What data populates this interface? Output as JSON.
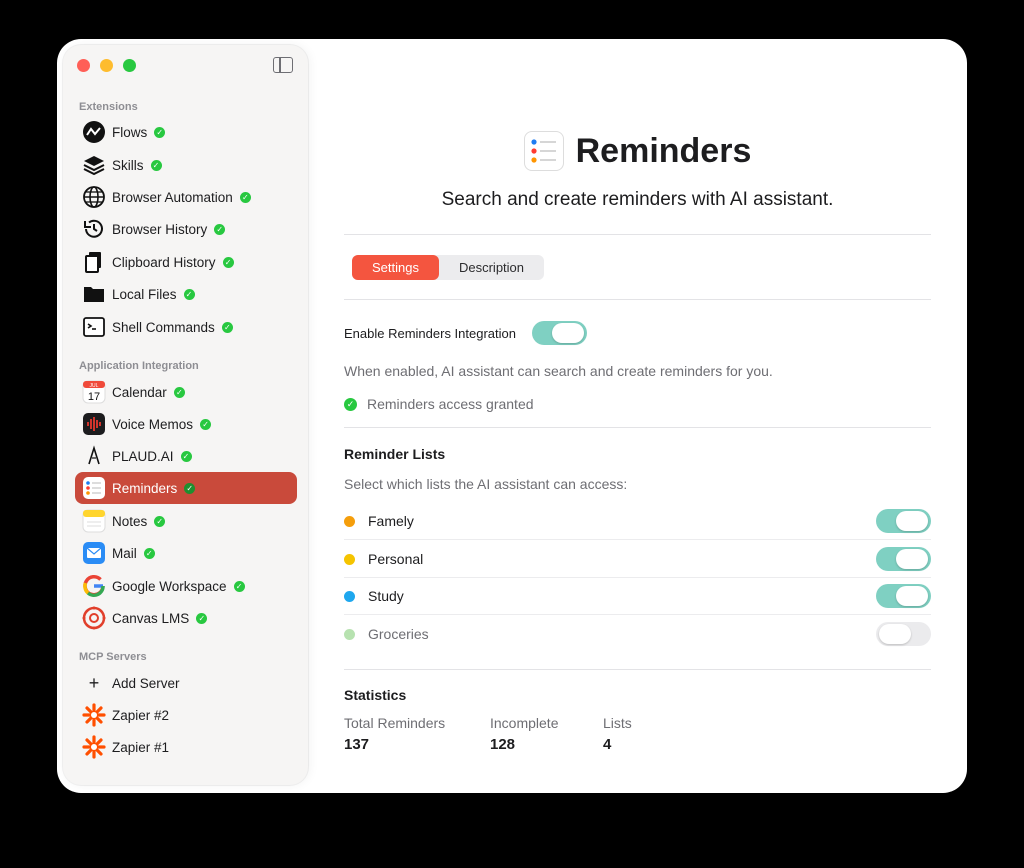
{
  "sidebar": {
    "sections": {
      "extensions": "Extensions",
      "app_integration": "Application Integration",
      "mcp": "MCP Servers"
    },
    "extensions": [
      {
        "label": "Flows",
        "icon": "flows-icon"
      },
      {
        "label": "Skills",
        "icon": "skills-icon"
      },
      {
        "label": "Browser Automation",
        "icon": "globe-icon"
      },
      {
        "label": "Browser History",
        "icon": "history-icon"
      },
      {
        "label": "Clipboard History",
        "icon": "clipboard-icon"
      },
      {
        "label": "Local Files",
        "icon": "folder-icon"
      },
      {
        "label": "Shell Commands",
        "icon": "terminal-icon"
      }
    ],
    "apps": [
      {
        "label": "Calendar",
        "icon": "calendar-icon",
        "badge_month": "JUL",
        "badge_day": "17"
      },
      {
        "label": "Voice Memos",
        "icon": "voice-memos-icon"
      },
      {
        "label": "PLAUD.AI",
        "icon": "plaud-icon"
      },
      {
        "label": "Reminders",
        "icon": "reminders-icon",
        "active": true
      },
      {
        "label": "Notes",
        "icon": "notes-icon"
      },
      {
        "label": "Mail",
        "icon": "mail-icon"
      },
      {
        "label": "Google Workspace",
        "icon": "google-icon"
      },
      {
        "label": "Canvas LMS",
        "icon": "canvas-icon"
      }
    ],
    "mcp": [
      {
        "label": "Add Server",
        "icon": "plus-icon"
      },
      {
        "label": "Zapier #2",
        "icon": "zapier-icon"
      },
      {
        "label": "Zapier #1",
        "icon": "zapier-icon"
      }
    ]
  },
  "main": {
    "title": "Reminders",
    "subtitle": "Search and create reminders with AI assistant.",
    "tabs": [
      "Settings",
      "Description"
    ],
    "enable_label": "Enable Reminders Integration",
    "enable_desc": "When enabled, AI assistant can search and create reminders for you.",
    "access_status": "Reminders access granted",
    "lists_heading": "Reminder Lists",
    "lists_desc": "Select which lists the AI assistant can access:",
    "lists": [
      {
        "name": "Famely",
        "color": "#f59e0b",
        "enabled": true
      },
      {
        "name": "Personal",
        "color": "#f5c400",
        "enabled": true
      },
      {
        "name": "Study",
        "color": "#1ea7ee",
        "enabled": true
      },
      {
        "name": "Groceries",
        "color": "#b7e2b0",
        "enabled": false
      }
    ],
    "stats_heading": "Statistics",
    "stats": [
      {
        "label": "Total Reminders",
        "value": "137"
      },
      {
        "label": "Incomplete",
        "value": "128"
      },
      {
        "label": "Lists",
        "value": "4"
      }
    ]
  },
  "colors": {
    "accent": "#f4553f",
    "active_item": "#c94a3b",
    "toggle_on": "#7fd0c2",
    "check": "#28c840"
  }
}
